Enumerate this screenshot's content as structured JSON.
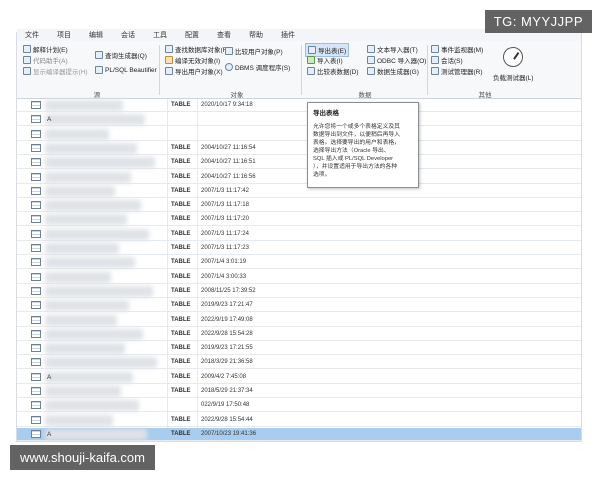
{
  "watermark_top": "TG: MYYJJPP",
  "watermark_bottom": "www.shouji-kaifa.com",
  "menu": [
    "文件",
    "项目",
    "编辑",
    "会话",
    "工具",
    "配置",
    "查看",
    "帮助",
    "插件"
  ],
  "ribbon": {
    "col1": [
      "解释计划(E)",
      "代码助手(A)",
      "显示编译器提示(H)"
    ],
    "group1": "源",
    "col2": [
      "查询生成器(Q)",
      "PL/SQL Beautifier"
    ],
    "col3": [
      "查找数据库对象(F)",
      "编译无效对象(I)",
      "导出用户对象(X)"
    ],
    "col4": [
      "比较用户对象(P)",
      "DBMS 调度程序(S)"
    ],
    "group2": "对象",
    "col5": [
      "导出表(E)",
      "导入表(I)",
      "比较表数据(D)"
    ],
    "col6": [
      "文本导入器(T)",
      "ODBC 导入器(O)",
      "数据生成器(G)"
    ],
    "group3": "数据",
    "col7": [
      "事件监视器(M)",
      "会话(S)",
      "测试管理器(R)"
    ],
    "col8": [
      "负载测试器(L)"
    ],
    "group4": "其他"
  },
  "tooltip": {
    "title": "导出表格",
    "body": "允许您将一个或多个表格定义及其\n数据导出到文件，以便稍后再导入\n表格。选择要导出的用户和表格，\n选择导出方法（Oracle 导出、\nSQL 插入或 PL/SQL Developer\n），并设置适用于导出方法的各种\n选项。"
  },
  "rows": [
    {
      "name": "",
      "type": "TABLE",
      "date": "2020/10/17 9:34:18"
    },
    {
      "name": "A",
      "type": "",
      "date": ""
    },
    {
      "name": "",
      "type": "",
      "date": ""
    },
    {
      "name": "",
      "type": "TABLE",
      "date": "2004/10/27 11:16:54"
    },
    {
      "name": "",
      "type": "TABLE",
      "date": "2004/10/27 11:16:51"
    },
    {
      "name": "",
      "type": "TABLE",
      "date": "2004/10/27 11:16:56"
    },
    {
      "name": "",
      "type": "TABLE",
      "date": "2007/1/3 11:17:42"
    },
    {
      "name": "",
      "type": "TABLE",
      "date": "2007/1/3 11:17:18"
    },
    {
      "name": "",
      "type": "TABLE",
      "date": "2007/1/3 11:17:20"
    },
    {
      "name": "",
      "type": "TABLE",
      "date": "2007/1/3 11:17:24"
    },
    {
      "name": "",
      "type": "TABLE",
      "date": "2007/1/3 11:17:23"
    },
    {
      "name": "",
      "type": "TABLE",
      "date": "2007/1/4 3:01:19"
    },
    {
      "name": "",
      "type": "TABLE",
      "date": "2007/1/4 3:00:33"
    },
    {
      "name": "",
      "type": "TABLE",
      "date": "2008/11/25 17:39:52"
    },
    {
      "name": "",
      "type": "TABLE",
      "date": "2019/9/23 17:21:47"
    },
    {
      "name": "",
      "type": "TABLE",
      "date": "2022/9/19 17:49:08"
    },
    {
      "name": "",
      "type": "TABLE",
      "date": "2022/9/28 15:54:28"
    },
    {
      "name": "",
      "type": "TABLE",
      "date": "2019/9/23 17:21:55"
    },
    {
      "name": "",
      "type": "TABLE",
      "date": "2018/3/29 21:36:58"
    },
    {
      "name": "A",
      "type": "TABLE",
      "date": "2009/4/2 7:45:08"
    },
    {
      "name": "",
      "type": "TABLE",
      "date": "2018/5/29 21:37:34"
    },
    {
      "name": "",
      "type": "",
      "date": "022/9/19 17:50:48"
    },
    {
      "name": "",
      "type": "TABLE",
      "date": "2022/9/28 15:54:44"
    },
    {
      "name": "A",
      "type": "TABLE",
      "date": "2007/10/23 19:41:36"
    }
  ]
}
